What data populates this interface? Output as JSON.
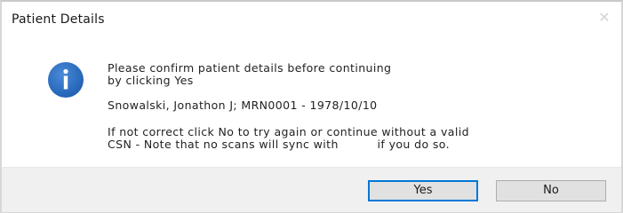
{
  "dialog": {
    "title": "Patient Details",
    "close_symbol": "✕",
    "icon": "info-icon",
    "message_line1": "Please confirm patient details before continuing",
    "message_line2": "by clicking Yes",
    "patient_line": "Snowalski, Jonathon J; MRN0001 - 1978/10/10",
    "warning_line1": "If not correct click No to try again or continue without a valid",
    "warning_line2": "CSN - Note that no scans will sync with          if you do so.",
    "buttons": {
      "yes_label": "Yes",
      "no_label": "No"
    }
  },
  "colors": {
    "icon_blue": "#2a70c8",
    "default_button_border": "#0078d7",
    "footer_bg": "#f0f0f0"
  }
}
